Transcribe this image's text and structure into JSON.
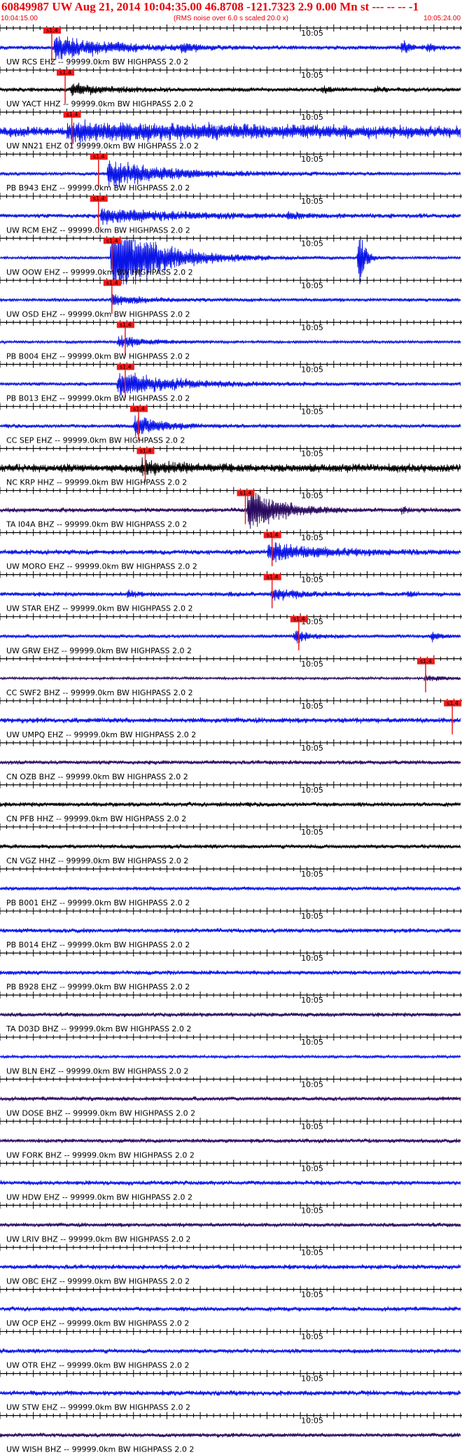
{
  "header": {
    "title": "60849987 UW Aug 21, 2014 10:04:35.00   46.8708 -121.7323  2.9 0.00 Mn st --- -- --  -1",
    "start_time": "10:04:15.00",
    "note": "(RMS noise over 6.0 s scaled 20.0 x)",
    "end_time": "10:05:24.00"
  },
  "colors": {
    "title": "#e8000b",
    "blue": "#0a14e6",
    "black": "#000000",
    "purple": "#2a0a5e",
    "pick_box": "#ee1c1c"
  },
  "chart_data": {
    "type": "line",
    "title": "60849987 UW Aug 21, 2014 10:04:35.00   46.8708 -121.7323  2.9 0.00 Mn st --- -- --  -1",
    "x_axis": {
      "start": "10:04:15.00",
      "end": "10:05:24.00",
      "major_tick_label": "10:05",
      "unit": "s",
      "range_s": [
        0,
        69
      ]
    },
    "scaling_note": "(RMS noise over 6.0 s scaled 20.0 x)",
    "pick_label": "s1.4",
    "channels": [
      {
        "label": "UW RCS EHZ -- 99999.0km BW  HIGHPASS  2.0  2",
        "color": "blue",
        "pick_s": 6.5,
        "bursts": [
          {
            "t": 8,
            "a": 0.9,
            "w": 14,
            "f": 1
          },
          {
            "t": 27,
            "a": 0.35,
            "w": 4,
            "f": 1
          },
          {
            "t": 60,
            "a": 0.8,
            "w": 2,
            "f": 0.8
          },
          {
            "t": 63.8,
            "a": 0.7,
            "w": 2,
            "f": 0.6
          }
        ],
        "noise": 0.14
      },
      {
        "label": "UW YACT HHZ -- 99999.0km BW  HIGHPASS  2.0  2",
        "color": "black",
        "pick_s": 8.5,
        "bursts": [
          {
            "t": 10.5,
            "a": 0.4,
            "w": 10,
            "f": 1
          },
          {
            "t": 48,
            "a": 0.25,
            "w": 3,
            "f": 1
          },
          {
            "t": 56,
            "a": 0.25,
            "w": 2,
            "f": 1
          }
        ],
        "noise": 0.14
      },
      {
        "label": "UW NN21 EHZ 01 99999.0km BW  HIGHPASS  2.0  2",
        "color": "blue",
        "pick_s": 9.5,
        "bursts": [
          {
            "t": 10,
            "a": 0.55,
            "w": 50,
            "f": 1
          }
        ],
        "noise": 0.35
      },
      {
        "label": "PB B943 EHZ -- 99999.0km BW  HIGHPASS  2.0  2",
        "color": "blue",
        "pick_s": 13.5,
        "bursts": [
          {
            "t": 16,
            "a": 1.0,
            "w": 16,
            "f": 1
          }
        ],
        "noise": 0.12
      },
      {
        "label": "UW RCM EHZ -- 99999.0km BW  HIGHPASS  2.0  2",
        "color": "blue",
        "pick_s": 13.5,
        "bursts": [
          {
            "t": 15,
            "a": 0.55,
            "w": 20,
            "f": 1
          },
          {
            "t": 43,
            "a": 0.25,
            "w": 3,
            "f": 1
          }
        ],
        "noise": 0.15
      },
      {
        "label": "UW OOW EHZ -- 99999.0km BW  HIGHPASS  2.0  2",
        "color": "blue",
        "pick_s": 15.5,
        "bursts": [
          {
            "t": 16.5,
            "a": 1.6,
            "w": 12,
            "f": 2
          },
          {
            "t": 53.5,
            "a": 1.6,
            "w": 1.5,
            "f": 2
          }
        ],
        "noise": 0.1
      },
      {
        "label": "UW OSD EHZ -- 99999.0km BW  HIGHPASS  2.0  2",
        "color": "blue",
        "pick_s": 15.5,
        "bursts": [
          {
            "t": 16.5,
            "a": 0.4,
            "w": 8,
            "f": 1
          }
        ],
        "noise": 0.12
      },
      {
        "label": "PB B004 EHZ -- 99999.0km BW  HIGHPASS  2.0  2",
        "color": "blue",
        "pick_s": 17.5,
        "bursts": [
          {
            "t": 17.5,
            "a": 0.45,
            "w": 8,
            "f": 1
          }
        ],
        "noise": 0.1
      },
      {
        "label": "PB B013 EHZ -- 99999.0km BW  HIGHPASS  2.0  2",
        "color": "blue",
        "pick_s": 17.5,
        "bursts": [
          {
            "t": 17.5,
            "a": 0.95,
            "w": 14,
            "f": 1
          }
        ],
        "noise": 0.12
      },
      {
        "label": "CC SEP EHZ -- 99999.0km BW  HIGHPASS  2.0  2",
        "color": "blue",
        "pick_s": 19.5,
        "bursts": [
          {
            "t": 20,
            "a": 0.9,
            "w": 7,
            "f": 1
          }
        ],
        "noise": 0.13
      },
      {
        "label": "NC KRP HHZ -- 99999.0km BW  HIGHPASS  2.0  2",
        "color": "black",
        "pick_s": 20.5,
        "bursts": [
          {
            "t": 21,
            "a": 0.45,
            "w": 10,
            "f": 1
          }
        ],
        "noise": 0.28
      },
      {
        "label": "TA I04A BHZ -- 99999.0km BW  HIGHPASS  2.0  2",
        "color": "purple",
        "pick_s": 35.5,
        "bursts": [
          {
            "t": 37,
            "a": 1.2,
            "w": 8,
            "f": 1.5
          },
          {
            "t": 60,
            "a": 0.3,
            "w": 1.5,
            "f": 1
          }
        ],
        "noise": 0.15
      },
      {
        "label": "UW MORO EHZ -- 99999.0km BW  HIGHPASS  2.0  2",
        "color": "blue",
        "pick_s": 39.5,
        "bursts": [
          {
            "t": 40,
            "a": 0.65,
            "w": 15,
            "f": 1
          }
        ],
        "noise": 0.17
      },
      {
        "label": "UW STAR EHZ -- 99999.0km BW  HIGHPASS  2.0  2",
        "color": "blue",
        "pick_s": 39.5,
        "bursts": [
          {
            "t": 40.5,
            "a": 0.45,
            "w": 7,
            "f": 1
          },
          {
            "t": 19,
            "a": 0.25,
            "w": 3,
            "f": 1
          },
          {
            "t": 61,
            "a": 0.3,
            "w": 1.5,
            "f": 1
          }
        ],
        "noise": 0.15
      },
      {
        "label": "UW GRW EHZ -- 99999.0km BW  HIGHPASS  2.0  2",
        "color": "blue",
        "pick_s": 43.5,
        "bursts": [
          {
            "t": 44,
            "a": 0.6,
            "w": 4,
            "f": 1
          },
          {
            "t": 64.5,
            "a": 0.4,
            "w": 2,
            "f": 1
          }
        ],
        "noise": 0.12
      },
      {
        "label": "CC SWF2 BHZ -- 99999.0km BW  HIGHPASS  2.0  2",
        "color": "purple",
        "pick_s": 62.5,
        "bursts": [
          {
            "t": 63.5,
            "a": 0.3,
            "w": 4,
            "f": 1
          }
        ],
        "noise": 0.08
      },
      {
        "label": "UW UMPQ EHZ -- 99999.0km BW  HIGHPASS  2.0  2",
        "color": "blue",
        "pick_s": 66.5,
        "bursts": [],
        "noise": 0.18
      },
      {
        "label": "CN OZB BHZ -- 99999.0km BW  HIGHPASS  2.0  2",
        "color": "purple",
        "pick_s": null,
        "bursts": [],
        "noise": 0.14
      },
      {
        "label": "CN PFB HHZ -- 99999.0km BW  HIGHPASS  2.0  2",
        "color": "black",
        "pick_s": null,
        "bursts": [],
        "noise": 0.15
      },
      {
        "label": "CN VGZ HHZ -- 99999.0km BW  HIGHPASS  2.0  2",
        "color": "black",
        "pick_s": null,
        "bursts": [],
        "noise": 0.14
      },
      {
        "label": "PB B001 EHZ -- 99999.0km BW  HIGHPASS  2.0  2",
        "color": "blue",
        "pick_s": null,
        "bursts": [],
        "noise": 0.13
      },
      {
        "label": "PB B014 EHZ -- 99999.0km BW  HIGHPASS  2.0  2",
        "color": "blue",
        "pick_s": null,
        "bursts": [],
        "noise": 0.15
      },
      {
        "label": "PB B928 EHZ -- 99999.0km BW  HIGHPASS  2.0  2",
        "color": "blue",
        "pick_s": null,
        "bursts": [],
        "noise": 0.15
      },
      {
        "label": "TA D03D BHZ -- 99999.0km BW  HIGHPASS  2.0  2",
        "color": "purple",
        "pick_s": null,
        "bursts": [],
        "noise": 0.14
      },
      {
        "label": "UW BLN EHZ -- 99999.0km BW  HIGHPASS  2.0  2",
        "color": "blue",
        "pick_s": null,
        "bursts": [],
        "noise": 0.1
      },
      {
        "label": "UW DOSE BHZ -- 99999.0km BW  HIGHPASS  2.0  2",
        "color": "purple",
        "pick_s": null,
        "bursts": [],
        "noise": 0.14
      },
      {
        "label": "UW FORK BHZ -- 99999.0km BW  HIGHPASS  2.0  2",
        "color": "purple",
        "pick_s": null,
        "bursts": [],
        "noise": 0.14
      },
      {
        "label": "UW HDW EHZ -- 99999.0km BW  HIGHPASS  2.0  2",
        "color": "blue",
        "pick_s": null,
        "bursts": [],
        "noise": 0.15
      },
      {
        "label": "UW LRIV BHZ -- 99999.0km BW  HIGHPASS  2.0  2",
        "color": "purple",
        "pick_s": null,
        "bursts": [],
        "noise": 0.14
      },
      {
        "label": "UW OBC EHZ -- 99999.0km BW  HIGHPASS  2.0  2",
        "color": "blue",
        "pick_s": null,
        "bursts": [],
        "noise": 0.16
      },
      {
        "label": "UW OCP EHZ -- 99999.0km BW  HIGHPASS  2.0  2",
        "color": "blue",
        "pick_s": null,
        "bursts": [],
        "noise": 0.15
      },
      {
        "label": "UW OTR EHZ -- 99999.0km BW  HIGHPASS  2.0  2",
        "color": "blue",
        "pick_s": null,
        "bursts": [],
        "noise": 0.15
      },
      {
        "label": "UW STW EHZ -- 99999.0km BW  HIGHPASS  2.0  2",
        "color": "blue",
        "pick_s": null,
        "bursts": [],
        "noise": 0.17
      },
      {
        "label": "UW WISH BHZ -- 99999.0km BW  HIGHPASS  2.0  2",
        "color": "purple",
        "pick_s": null,
        "bursts": [],
        "noise": 0.14
      }
    ]
  }
}
